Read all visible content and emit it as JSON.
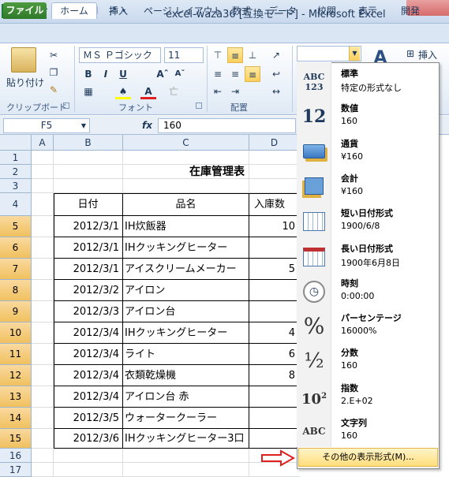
{
  "window": {
    "title": "excel-waza36 [互換モード] - Microsoft Excel"
  },
  "tabs": {
    "file": "ファイル",
    "items": [
      "ホーム",
      "挿入",
      "ページ レイアウト",
      "数式",
      "データ",
      "校閲",
      "表示",
      "開発"
    ]
  },
  "ribbon": {
    "paste_label": "貼り付け",
    "font_name": "ＭＳ Ｐゴシック",
    "font_size": "11",
    "insert_label": "挿入",
    "groups": {
      "clipboard": "クリップボード",
      "font": "フォント",
      "alignment": "配置"
    }
  },
  "formula_bar": {
    "name_box": "F5",
    "fx": "fx",
    "value": "160"
  },
  "sheet": {
    "columns": [
      "A",
      "B",
      "C",
      "D"
    ],
    "rows": [
      "1",
      "2",
      "3",
      "4",
      "5",
      "6",
      "7",
      "8",
      "9",
      "10",
      "11",
      "12",
      "13",
      "14",
      "15",
      "16",
      "17"
    ],
    "title": "在庫管理表",
    "headers": {
      "date": "日付",
      "item": "品名",
      "qty": "入庫数"
    },
    "records": [
      {
        "date": "2012/3/1",
        "item": "IH炊飯器",
        "qty": "10"
      },
      {
        "date": "2012/3/1",
        "item": "IHクッキングヒーター",
        "qty": ""
      },
      {
        "date": "2012/3/1",
        "item": "アイスクリームメーカー",
        "qty": "5"
      },
      {
        "date": "2012/3/2",
        "item": "アイロン",
        "qty": ""
      },
      {
        "date": "2012/3/3",
        "item": "アイロン台",
        "qty": ""
      },
      {
        "date": "2012/3/4",
        "item": "IHクッキングヒーター",
        "qty": "4"
      },
      {
        "date": "2012/3/4",
        "item": "ライト",
        "qty": "6"
      },
      {
        "date": "2012/3/4",
        "item": "衣類乾燥機",
        "qty": "8"
      },
      {
        "date": "2012/3/4",
        "item": "アイロン台 赤",
        "qty": ""
      },
      {
        "date": "2012/3/5",
        "item": "ウォータークーラー",
        "qty": ""
      },
      {
        "date": "2012/3/6",
        "item": "IHクッキングヒーター3口",
        "qty": ""
      }
    ]
  },
  "format_menu": {
    "items": [
      {
        "title": "標準",
        "sample": "特定の形式なし",
        "icon": "ABC 123"
      },
      {
        "title": "数値",
        "sample": "160",
        "icon": "12"
      },
      {
        "title": "通貨",
        "sample": "¥160",
        "icon": "currency-icon"
      },
      {
        "title": "会計",
        "sample": " ¥160",
        "icon": "accounting-icon"
      },
      {
        "title": "短い日付形式",
        "sample": "1900/6/8",
        "icon": "calendar-icon"
      },
      {
        "title": "長い日付形式",
        "sample": "1900年6月8日",
        "icon": "calendar-icon"
      },
      {
        "title": "時刻",
        "sample": "0:00:00",
        "icon": "clock-icon"
      },
      {
        "title": "パーセンテージ",
        "sample": "16000%",
        "icon": "%"
      },
      {
        "title": "分数",
        "sample": "160",
        "icon": "½"
      },
      {
        "title": "指数",
        "sample": "2.E+02",
        "icon": "10²"
      },
      {
        "title": "文字列",
        "sample": "160",
        "icon": "ABC"
      }
    ],
    "more": "その他の表示形式(M)..."
  },
  "colors": {
    "selected_row": "#f1c15f",
    "arrow": "#e02020",
    "file_tab": "#2f7a2a"
  }
}
